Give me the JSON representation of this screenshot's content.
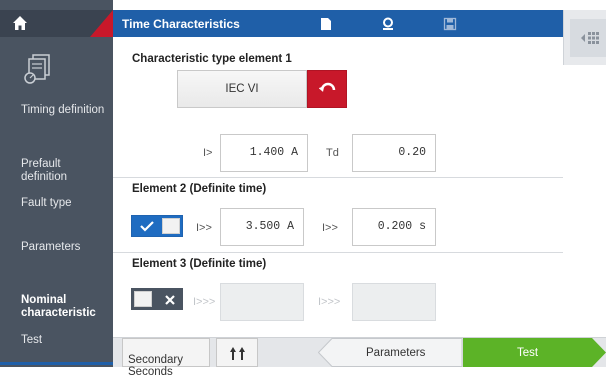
{
  "sidebar": {
    "items": [
      {
        "label": "Timing definition"
      },
      {
        "label": "Prefault\ndefinition"
      },
      {
        "label": "Fault type"
      },
      {
        "label": "Parameters"
      },
      {
        "label": "Nominal\ncharacteristic"
      },
      {
        "label": "Test"
      }
    ],
    "active_index": 4
  },
  "header": {
    "title": "Time Characteristics",
    "icons": [
      "document-icon",
      "record-icon",
      "save-icon",
      "panel-toggle-icon"
    ]
  },
  "element1": {
    "title": "Characteristic type element 1",
    "type_value": "IEC VI",
    "i_label": "I>",
    "i_value": "1.400 A",
    "td_label": "Td",
    "td_value": "0.20"
  },
  "element2": {
    "title": "Element 2 (Definite time)",
    "enabled": true,
    "i_label": "I>>",
    "i_value": "3.500 A",
    "t_label": "I>>",
    "t_value": "0.200 s"
  },
  "element3": {
    "title": "Element 3 (Definite time)",
    "enabled": false,
    "i_label": "I>>>",
    "i_value": "",
    "t_label": "I>>>",
    "t_value": ""
  },
  "bottom": {
    "secondary_label": "Secondary\nSeconds",
    "parameters_label": "Parameters",
    "test_label": "Test"
  },
  "colors": {
    "header_blue": "#1f5fa8",
    "accent_red": "#c8182a",
    "sidebar_bg": "#4a5461",
    "test_green": "#5cb327"
  }
}
